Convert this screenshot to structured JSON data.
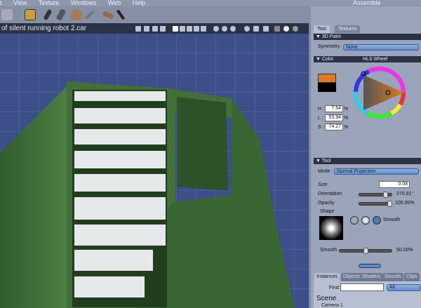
{
  "menu": [
    "t",
    "View",
    "Texture",
    "Windows",
    "Web",
    "Help"
  ],
  "room": "Assemble",
  "viewport": {
    "title": "of silent running robot 2.car"
  },
  "panel": {
    "tabs": [
      "Tool",
      "Textures"
    ],
    "paint": {
      "header": "3D Paint",
      "symmetry_label": "Symmetry",
      "symmetry_value": "None"
    },
    "color": {
      "header": "Color",
      "mode": "HLS Wheel",
      "h_label": "H :",
      "h": "7.54",
      "l_label": "L :",
      "l": "53.94",
      "s_label": "S :",
      "s": "74.27",
      "unit": "%",
      "fg": "#e07a22",
      "bg": "#000000"
    },
    "tool": {
      "header": "Tool",
      "mode_label": "Mode",
      "mode_value": "Normal Projection",
      "size_label": "Size",
      "size": "0.08",
      "orientation_label": "Orientation",
      "orientation": "270.91°",
      "orientation_fraction": 0.75,
      "opacity_label": "Opacity",
      "opacity": "100.00%",
      "opacity_fraction": 1.0,
      "shape_label": "Shape",
      "shape_name": "Smooth",
      "smooth_label": "Smooth",
      "smooth": "50.00%",
      "smooth_fraction": 0.5
    }
  },
  "bottom": {
    "tabs": [
      "Instances",
      "Objects",
      "Shaders",
      "Sounds",
      "Clips"
    ],
    "find_label": "Find:",
    "find_value": "",
    "filter": "All",
    "scene": "Scene",
    "items": [
      "Camera 1"
    ]
  }
}
